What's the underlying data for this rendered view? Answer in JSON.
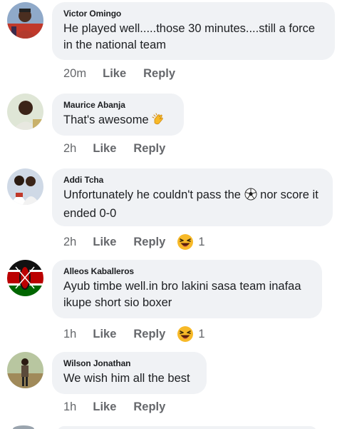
{
  "comments": [
    {
      "author": "Victor Omingo",
      "text": "He played well.....those 30 minutes....still a force in the national team",
      "time": "20m",
      "like_label": "Like",
      "reply_label": "Reply"
    },
    {
      "author": "Maurice Abanja",
      "text": "That's awesome",
      "text_emoji": "clapping-hands-icon",
      "time": "2h",
      "like_label": "Like",
      "reply_label": "Reply"
    },
    {
      "author": "Addi Tcha",
      "text_before": "Unfortunately he couldn't pass the",
      "text_after": "nor score it  ended 0-0",
      "text_emoji": "soccer-ball-icon",
      "time": "2h",
      "like_label": "Like",
      "reply_label": "Reply",
      "reaction_icon": "laughing-emoji-icon",
      "reaction_count": "1"
    },
    {
      "author": "Alleos Kaballeros",
      "text": "Ayub timbe well.in bro lakini sasa team inafaa ikupe short sio boxer",
      "time": "1h",
      "like_label": "Like",
      "reply_label": "Reply",
      "reaction_icon": "laughing-emoji-icon",
      "reaction_count": "1"
    },
    {
      "author": "Wilson Jonathan",
      "text": "We wish him all the best",
      "time": "1h",
      "like_label": "Like",
      "reply_label": "Reply"
    }
  ],
  "colors": {
    "bubble": "#f0f2f5",
    "meta": "#65676b",
    "text": "#1c1e21",
    "reaction": "#f7b928"
  }
}
